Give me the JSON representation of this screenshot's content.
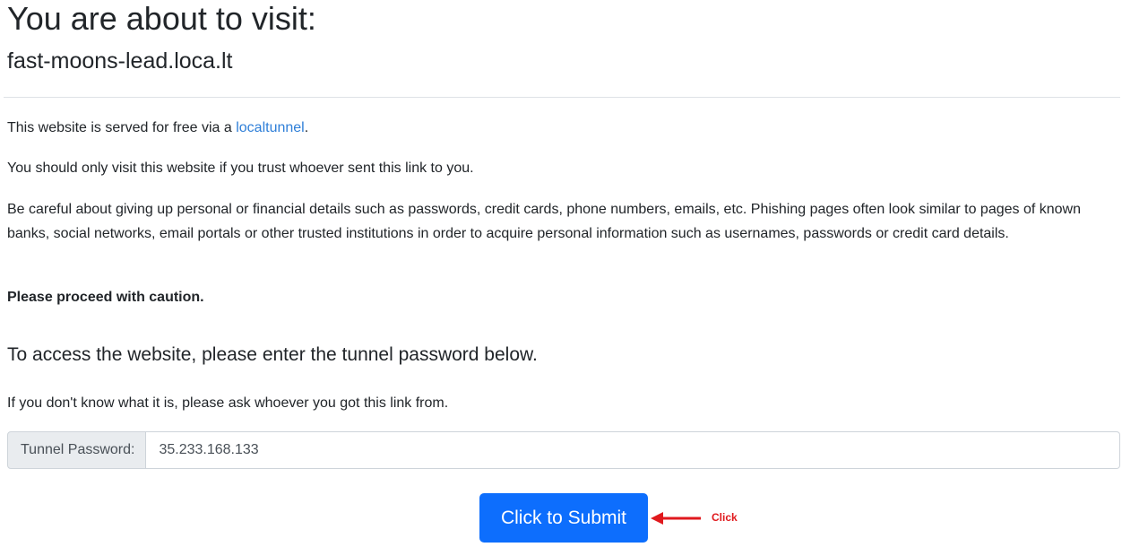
{
  "page": {
    "title": "You are about to visit:",
    "host": "fast-moons-lead.loca.lt"
  },
  "intro": {
    "served_prefix": "This website is served for free via a ",
    "served_link": "localtunnel",
    "served_suffix": ".",
    "trust_text": "You should only visit this website if you trust whoever sent this link to you.",
    "warning_text": "Be careful about giving up personal or financial details such as passwords, credit cards, phone numbers, emails, etc. Phishing pages often look similar to pages of known banks, social networks, email portals or other trusted institutions in order to acquire personal information such as usernames, passwords or credit card details.",
    "caution_text": "Please proceed with caution."
  },
  "access": {
    "heading": "To access the website, please enter the tunnel password below.",
    "help_text": "If you don't know what it is, please ask whoever you got this link from."
  },
  "form": {
    "password_label": "Tunnel Password:",
    "password_value": "35.233.168.133",
    "submit_label": "Click to Submit"
  },
  "annotation": {
    "label": "Click",
    "arrow_icon": "left-arrow-icon",
    "color": "#e0191d"
  },
  "colors": {
    "link": "#2f7fd8",
    "button": "#0d6efd",
    "text": "#212529"
  }
}
